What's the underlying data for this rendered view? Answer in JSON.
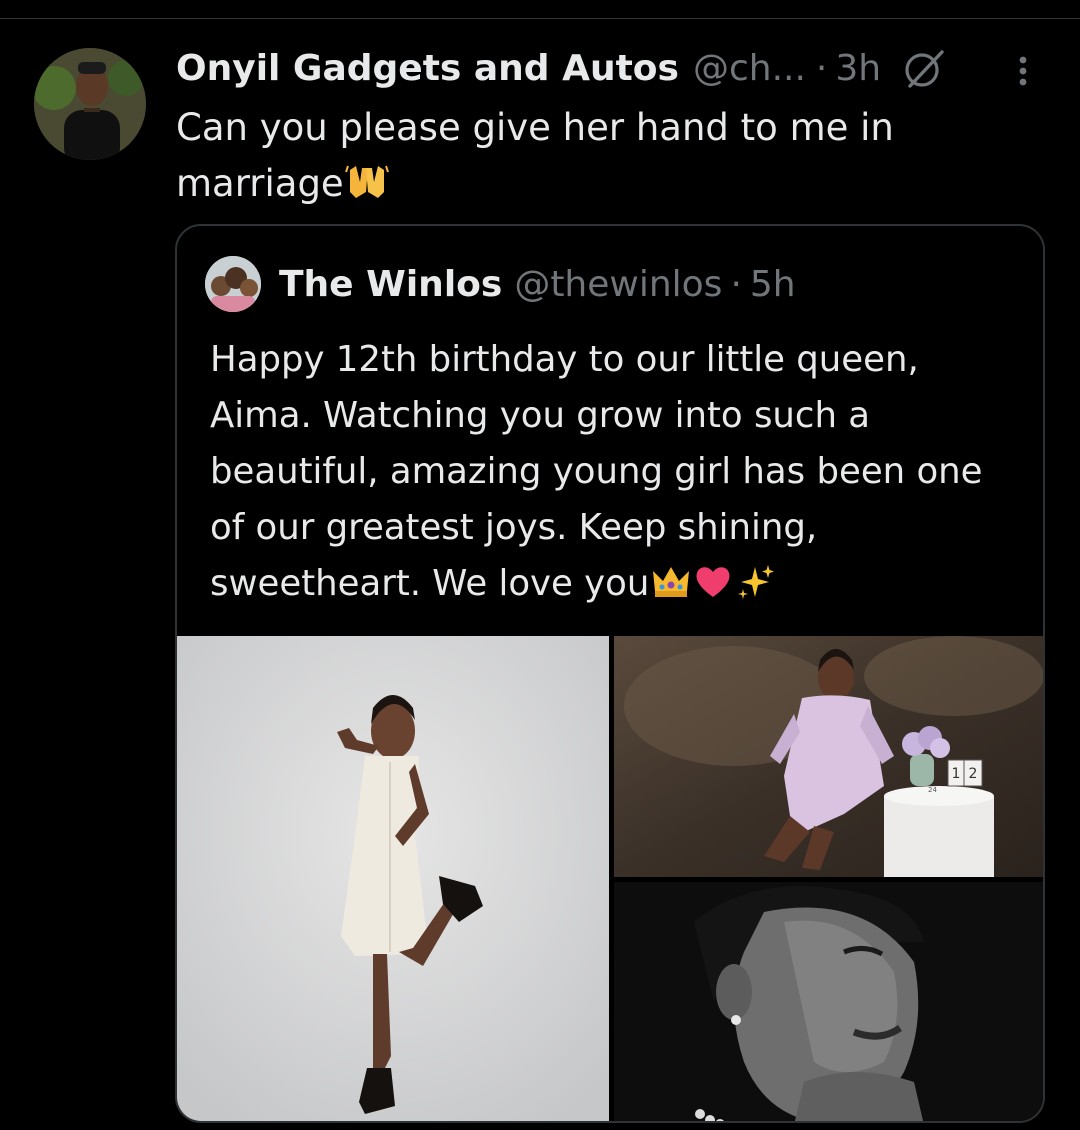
{
  "tweet": {
    "author_name": "Onyil Gadgets and Autos",
    "author_handle": "@ch...",
    "separator": "·",
    "time": "3h",
    "text": "Can you please give her hand to me in marriage",
    "emoji": "raising-hands-emoji"
  },
  "icons": {
    "grok": "grok-icon",
    "more": "more-options-icon"
  },
  "quoted": {
    "author_name": "The Winlos",
    "author_handle": "@thewinlos",
    "separator": "·",
    "time": "5h",
    "text": "Happy 12th birthday to our little queen, Aima. Watching you grow into such a beautiful, amazing young girl has been one of our greatest joys. Keep shining, sweetheart. We love you",
    "emojis": [
      "crown-emoji",
      "heart-emoji",
      "sparkles-emoji"
    ],
    "photos": [
      "girl-in-white-dress-photo",
      "girl-in-lilac-dress-photo",
      "black-and-white-portrait-photo"
    ],
    "props": {
      "age_blocks": [
        "1",
        "2"
      ],
      "cake_number": "24"
    }
  },
  "colors": {
    "background": "#000000",
    "text_primary": "#e7e9ea",
    "text_secondary": "#71767b",
    "border": "#2f3336"
  }
}
